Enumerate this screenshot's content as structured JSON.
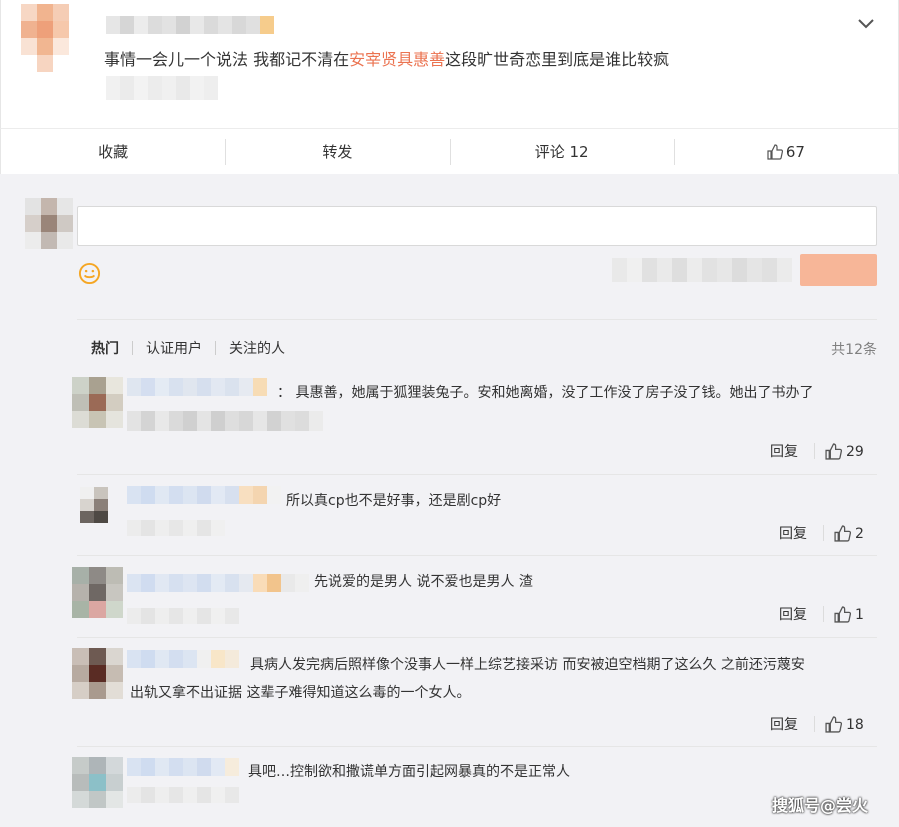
{
  "post": {
    "text_before": "事情一会儿一个说法 我都记不清在",
    "text_highlight": "安宰贤具惠善",
    "text_after": "这段旷世奇恋里到底是谁比较疯"
  },
  "actions": {
    "collect": "收藏",
    "forward": "转发",
    "comment": "评论 12",
    "like_count": "67"
  },
  "tabs": {
    "hot": "热门",
    "verified": "认证用户",
    "following": "关注的人",
    "total": "共12条"
  },
  "comments": [
    {
      "text": "：  具惠善，她属于狐狸装兔子。安和她离婚，没了工作没了房子没了钱。她出了书办了",
      "reply": "回复",
      "likes": "29"
    },
    {
      "text": "所以真cp也不是好事，还是剧cp好",
      "reply": "回复",
      "likes": "2"
    },
    {
      "text": "先说爱的是男人 说不爱也是男人 渣",
      "reply": "回复",
      "likes": "1"
    },
    {
      "text_line1": "具病人发完病后照样像个没事人一样上综艺接采访 而安被迫空档期了这么久 之前还污蔑安",
      "text_line2": "出轨又拿不出证据 这辈子难得知道这么毒的一个女人。",
      "reply": "回复",
      "likes": "18"
    },
    {
      "text": "具吧…控制欲和撒谎单方面引起网暴真的不是正常人"
    }
  ],
  "watermark": "搜狐号@尝火",
  "colors": {
    "accent": "#eb7350",
    "submit": "#f7b698"
  }
}
